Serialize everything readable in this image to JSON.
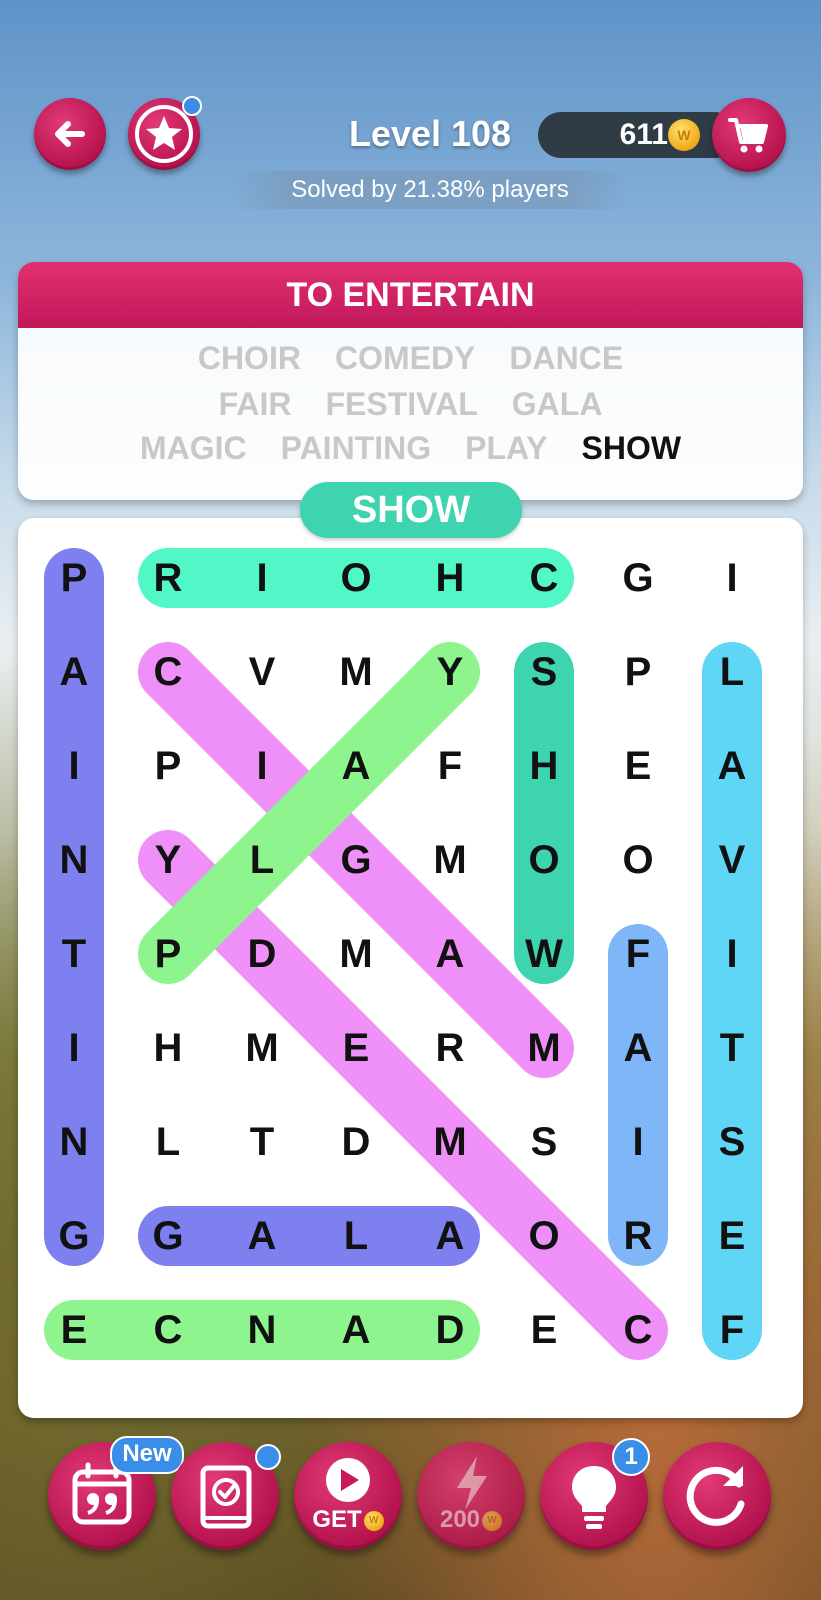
{
  "header": {
    "level_label": "Level 108",
    "solved_text": "Solved by 21.38% players",
    "coins": "611",
    "coin_symbol": "W"
  },
  "category": {
    "title": "TO ENTERTAIN",
    "word_rows": [
      [
        {
          "word": "CHOIR",
          "found": true
        },
        {
          "word": "COMEDY",
          "found": true
        },
        {
          "word": "DANCE",
          "found": true
        }
      ],
      [
        {
          "word": "FAIR",
          "found": true
        },
        {
          "word": "FESTIVAL",
          "found": true
        },
        {
          "word": "GALA",
          "found": true
        }
      ],
      [
        {
          "word": "MAGIC",
          "found": true
        },
        {
          "word": "PAINTING",
          "found": true
        },
        {
          "word": "PLAY",
          "found": true
        },
        {
          "word": "SHOW",
          "found": false
        }
      ]
    ],
    "current_word": "SHOW"
  },
  "grid": {
    "rows": [
      [
        "P",
        "R",
        "I",
        "O",
        "H",
        "C",
        "G",
        "I"
      ],
      [
        "A",
        "C",
        "V",
        "M",
        "Y",
        "S",
        "P",
        "L"
      ],
      [
        "I",
        "P",
        "I",
        "A",
        "F",
        "H",
        "E",
        "A"
      ],
      [
        "N",
        "Y",
        "L",
        "G",
        "M",
        "O",
        "O",
        "V"
      ],
      [
        "T",
        "P",
        "D",
        "M",
        "A",
        "W",
        "F",
        "I"
      ],
      [
        "I",
        "H",
        "M",
        "E",
        "R",
        "M",
        "A",
        "T"
      ],
      [
        "N",
        "L",
        "T",
        "D",
        "M",
        "S",
        "I",
        "S"
      ],
      [
        "G",
        "G",
        "A",
        "L",
        "A",
        "O",
        "R",
        "E"
      ],
      [
        "E",
        "C",
        "N",
        "A",
        "D",
        "E",
        "C",
        "F"
      ]
    ],
    "highlights": [
      {
        "word": "PAINTING",
        "from": [
          0,
          0
        ],
        "to": [
          7,
          0
        ],
        "color": "#7f80f0"
      },
      {
        "word": "CHOIR",
        "from": [
          0,
          5
        ],
        "to": [
          0,
          1
        ],
        "color": "#52f7c8"
      },
      {
        "word": "COMEDY",
        "from": [
          1,
          1
        ],
        "to": [
          5,
          5
        ],
        "color": "#ee90f7"
      },
      {
        "word": "MAGIC",
        "from": [
          3,
          1
        ],
        "to": [
          8,
          6
        ],
        "color": "#ee90f7"
      },
      {
        "word": "PLAY",
        "from": [
          4,
          1
        ],
        "to": [
          1,
          4
        ],
        "color": "#8ef58e"
      },
      {
        "word": "SHOW",
        "from": [
          1,
          5
        ],
        "to": [
          4,
          5
        ],
        "color": "#3fd4b0",
        "in_progress": true
      },
      {
        "word": "FAIR",
        "from": [
          4,
          6
        ],
        "to": [
          7,
          6
        ],
        "color": "#7eb6f7"
      },
      {
        "word": "FESTIVAL",
        "from": [
          8,
          7
        ],
        "to": [
          1,
          7
        ],
        "color": "#5fd6f5"
      },
      {
        "word": "GALA",
        "from": [
          7,
          1
        ],
        "to": [
          7,
          4
        ],
        "color": "#7f80f0"
      },
      {
        "word": "DANCE",
        "from": [
          8,
          4
        ],
        "to": [
          8,
          0
        ],
        "color": "#8ef58e"
      }
    ],
    "white_letter_cells": [
      [
        1,
        5
      ],
      [
        2,
        5
      ],
      [
        3,
        5
      ],
      [
        4,
        5
      ]
    ]
  },
  "toolbar": {
    "daily_badge": "New",
    "video_label": "GET",
    "boost_cost": "200",
    "hint_count": "1"
  },
  "colors": {
    "accent": "#c7185b",
    "badge_blue": "#3a8ee8",
    "current_word": "#3fd4b0"
  },
  "icons": [
    "back-arrow-icon",
    "star-icon",
    "cart-icon",
    "coin-icon",
    "calendar-icon",
    "book-check-icon",
    "play-icon",
    "lightning-icon",
    "lightbulb-icon",
    "refresh-icon"
  ]
}
